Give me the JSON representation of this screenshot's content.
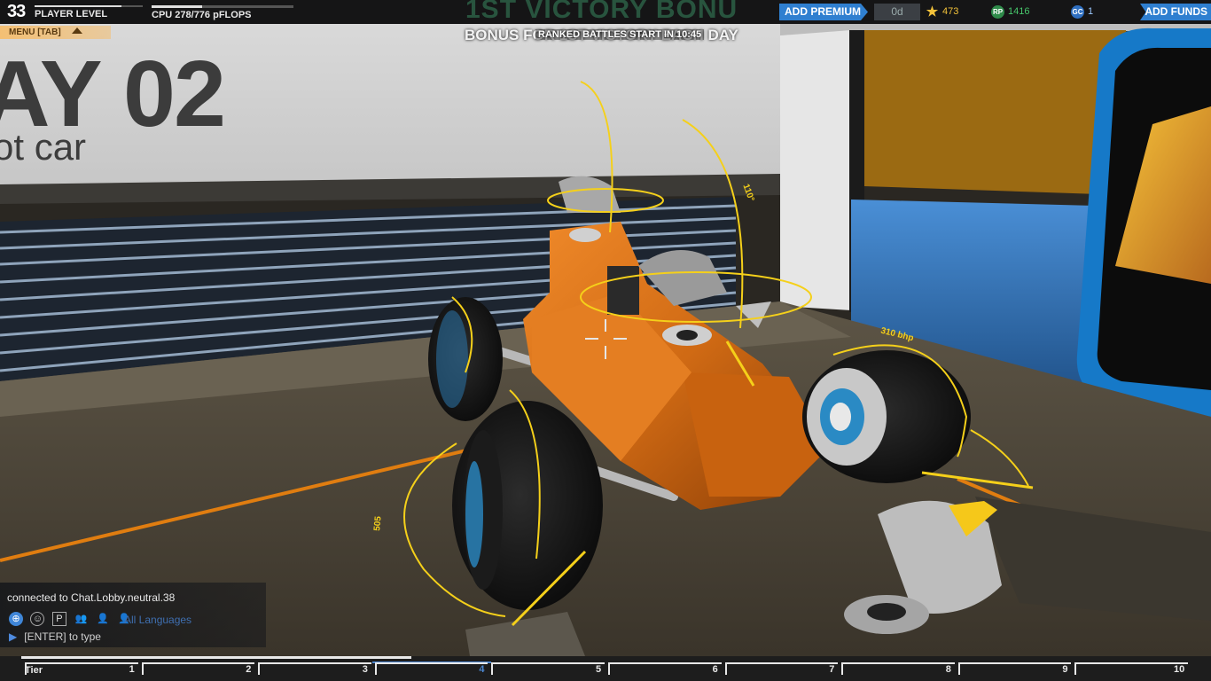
{
  "hud": {
    "player_level": "33",
    "player_level_label": "PLAYER LEVEL",
    "cpu_label": "CPU 278/776 pFLOPS",
    "cpu_fraction": 0.358,
    "level_progress": 0.8,
    "add_premium": "ADD PREMIUM",
    "premium_days": "0d",
    "stars": "473",
    "rp": "1416",
    "gc": "1",
    "add_funds": "ADD FUNDS",
    "menu_tab": "MENU [TAB]"
  },
  "banner": {
    "bonus_bg": "1ST VICTORY BONU",
    "bonus_line": "BONUS FOR 1ST VICTORY EACH DAY",
    "ranked": "RANKED BATTLES START IN 10:45"
  },
  "wall": {
    "day_text": "AY 02",
    "sub_text": "ot car"
  },
  "robot": {
    "power_front": "310 bhp",
    "power_left": "505",
    "angle_top": "110°"
  },
  "chat": {
    "status": "connected to Chat.Lobby.neutral.38",
    "language": "All Languages",
    "prompt": "[ENTER] to type"
  },
  "tiers": {
    "label": "Tier",
    "numbers": [
      "1",
      "2",
      "3",
      "4",
      "5",
      "6",
      "7",
      "8",
      "9",
      "10"
    ],
    "active": "4"
  },
  "colors": {
    "accent_blue": "#2f7fd0",
    "hull_orange": "#d8741c",
    "guide_yellow": "#f5d01a"
  }
}
